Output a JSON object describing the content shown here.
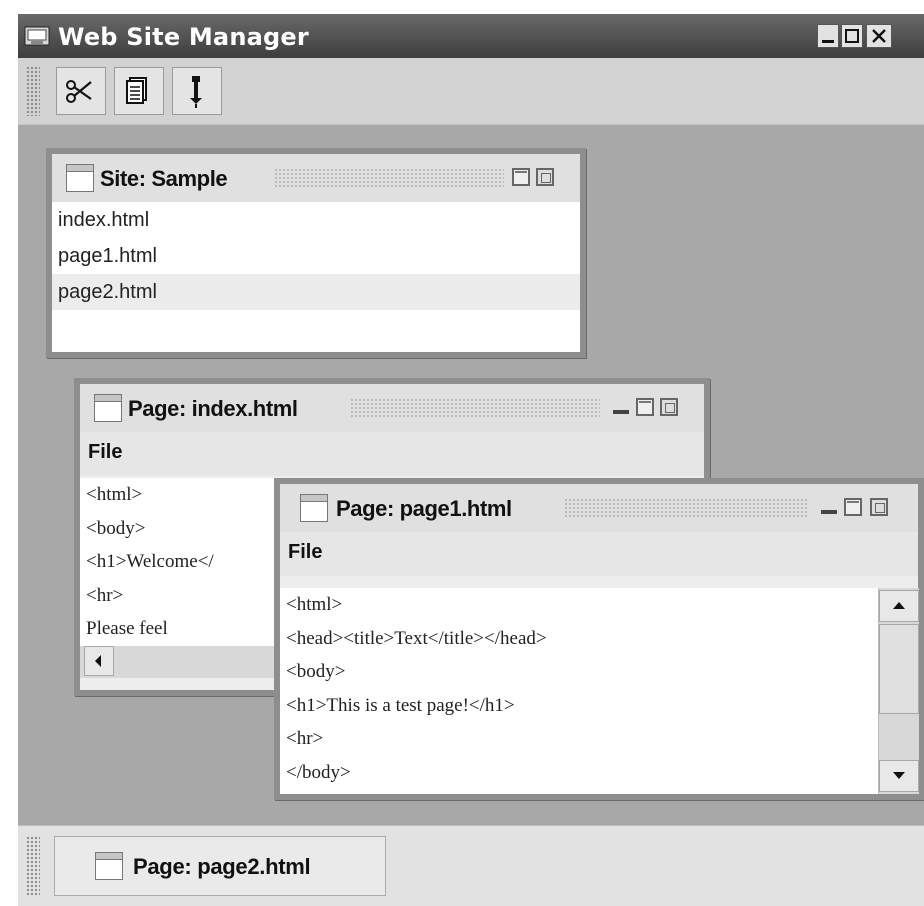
{
  "app": {
    "title": "Web Site Manager"
  },
  "window_controls": {
    "minimize": "minimize-button",
    "maximize": "maximize-button",
    "close": "close-button"
  },
  "toolbar": {
    "buttons": [
      {
        "icon": "scissors-icon"
      },
      {
        "icon": "document-icon"
      },
      {
        "icon": "pin-icon"
      }
    ]
  },
  "site_window": {
    "title": "Site: Sample",
    "files": [
      "index.html",
      "page1.html",
      "page2.html"
    ],
    "selected": "page2.html"
  },
  "index_window": {
    "title": "Page: index.html",
    "menu": "File",
    "lines": [
      "<html>",
      "<body>",
      "<h1>Welcome</",
      "<hr>",
      "Please feel"
    ]
  },
  "page1_window": {
    "title": "Page: page1.html",
    "menu": "File",
    "lines": [
      "<html>",
      "<head><title>Text</title></head>",
      "<body>",
      "<h1>This is a test page!</h1>",
      "<hr>",
      "</body>"
    ]
  },
  "taskbar": {
    "minimized": "Page: page2.html"
  },
  "colors": {
    "titlebar": "#4a4a4a",
    "desktop": "#a8a8a8",
    "frame": "#8e8e8e"
  }
}
